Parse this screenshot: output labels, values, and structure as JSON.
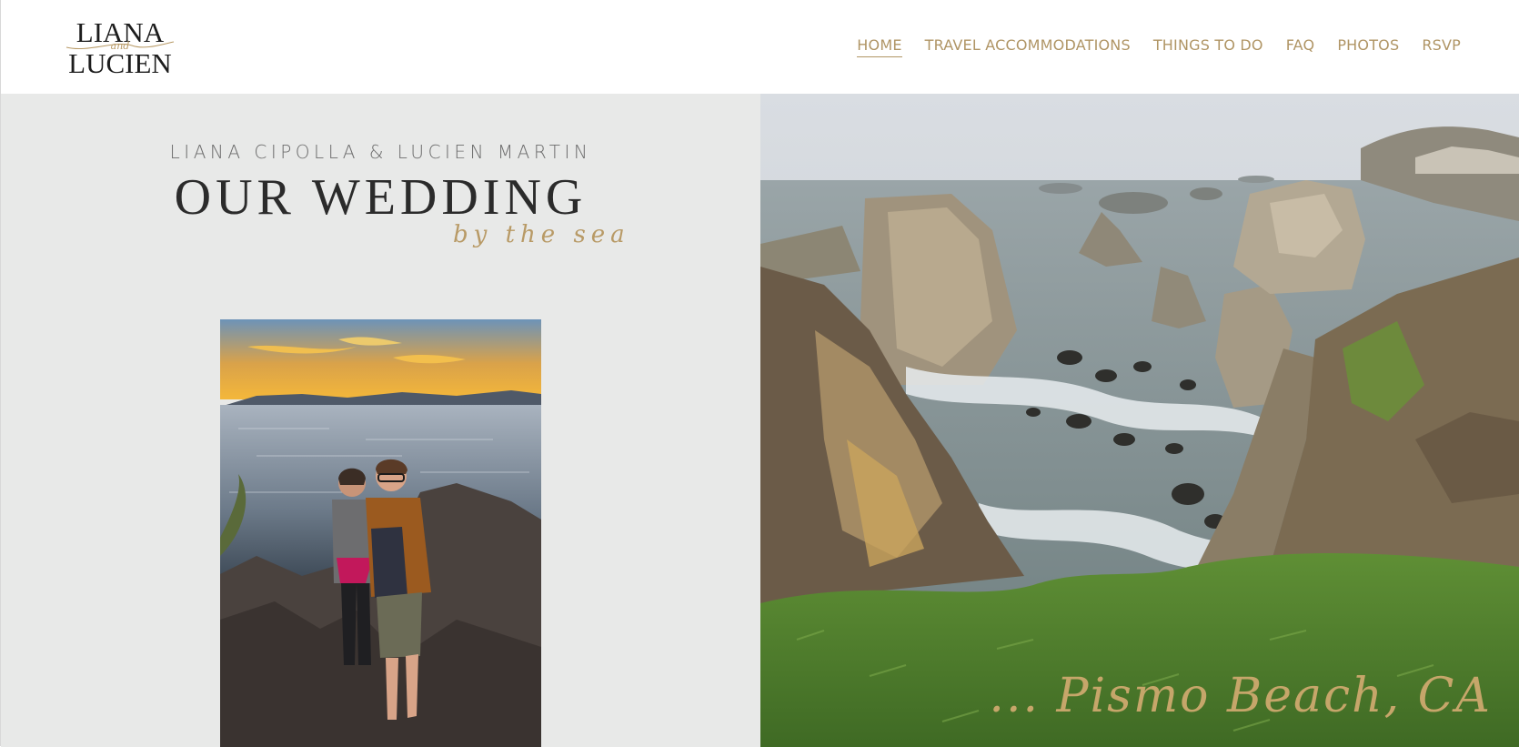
{
  "header": {
    "logo": {
      "top": "LIANA",
      "middle": "and",
      "bottom": "LUCIEN"
    },
    "nav": [
      {
        "label": "HOME",
        "active": true
      },
      {
        "label": "TRAVEL ACCOMMODATIONS",
        "active": false
      },
      {
        "label": "THINGS TO DO",
        "active": false
      },
      {
        "label": "FAQ",
        "active": false
      },
      {
        "label": "PHOTOS",
        "active": false
      },
      {
        "label": "RSVP",
        "active": false
      }
    ]
  },
  "hero": {
    "names": "LIANA CIPOLLA & LUCIEN MARTIN",
    "title": "OUR WEDDING",
    "tagline": "by the sea",
    "location": "... Pismo Beach, CA"
  },
  "colors": {
    "accent": "#b09565",
    "panel_bg": "#e8e9e8",
    "heading": "#2b2b2b"
  }
}
